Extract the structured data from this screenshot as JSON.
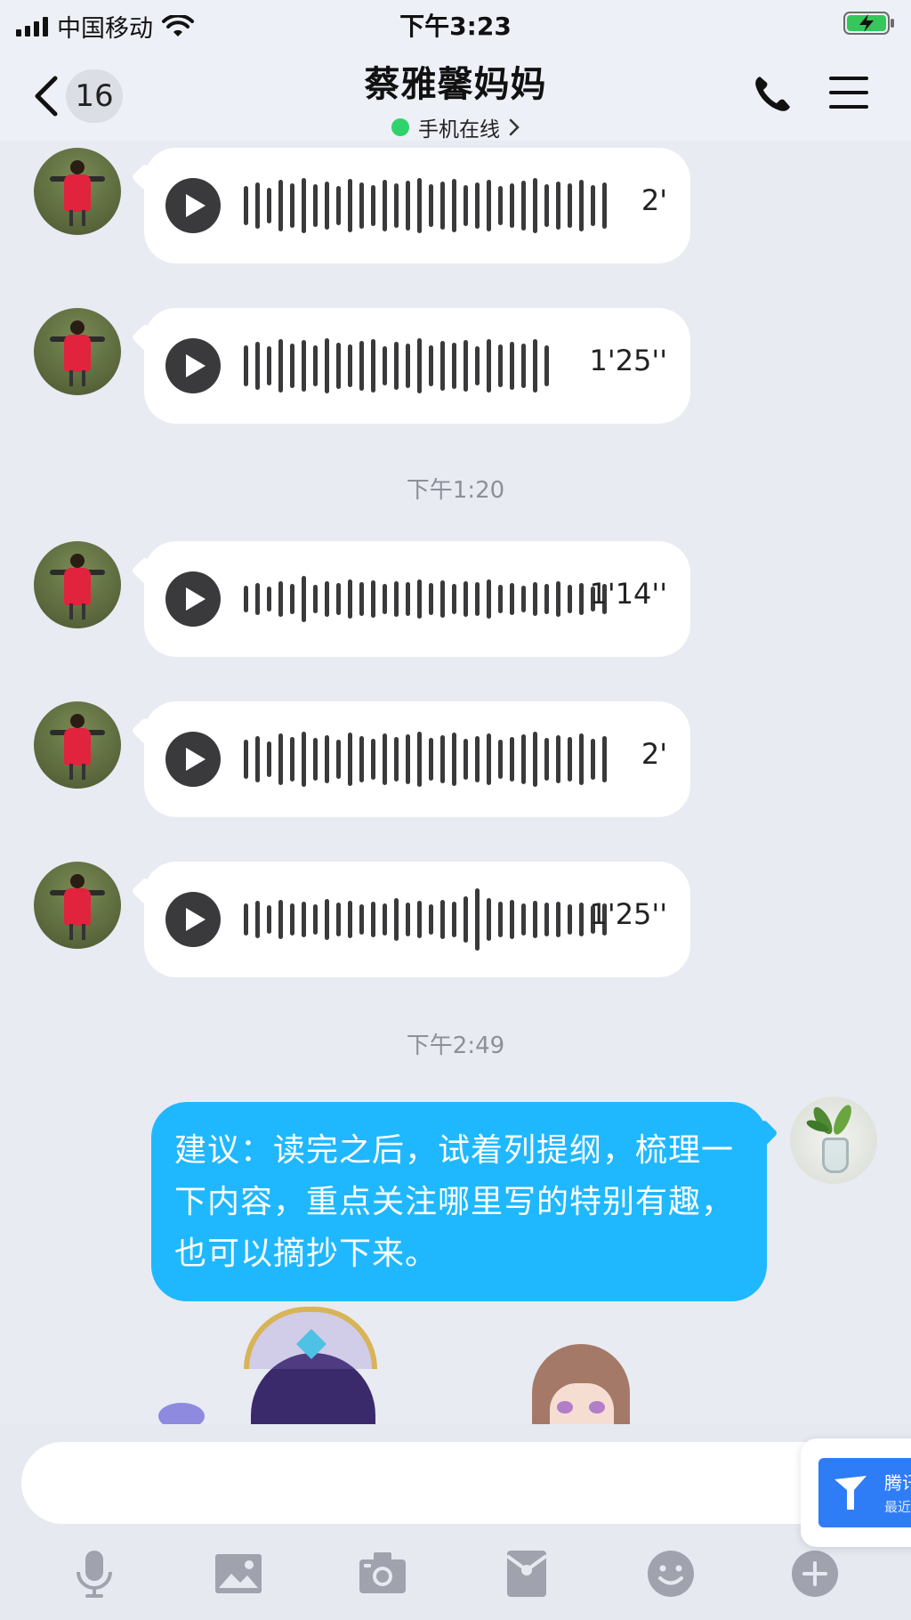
{
  "status_bar": {
    "carrier": "中国移动",
    "time": "下午3:23"
  },
  "nav": {
    "unread_count": "16",
    "title": "蔡雅馨妈妈",
    "presence": "手机在线"
  },
  "messages": {
    "voice": [
      {
        "duration": "2'"
      },
      {
        "duration": "1'25''"
      },
      {
        "duration": "1'14''"
      },
      {
        "duration": "2'"
      },
      {
        "duration": "1'25''"
      }
    ],
    "time_separators": [
      "下午1:20",
      "下午2:49"
    ],
    "my_text": "建议：读完之后，试着列提纲，梳理一下内容，重点关注哪里写的特别有趣，也可以摘抄下来。"
  },
  "input": {
    "placeholder": ""
  },
  "float_card": {
    "title": "腾讯",
    "subtitle": "最近"
  },
  "colors": {
    "my_bubble": "#1fb8ff",
    "online_dot": "#2fd36b",
    "toolbar_icon": "#a0a3ad"
  },
  "icons": {
    "toolbar": [
      "microphone-icon",
      "image-icon",
      "camera-icon",
      "red-packet-icon",
      "emoji-icon",
      "plus-icon"
    ]
  }
}
